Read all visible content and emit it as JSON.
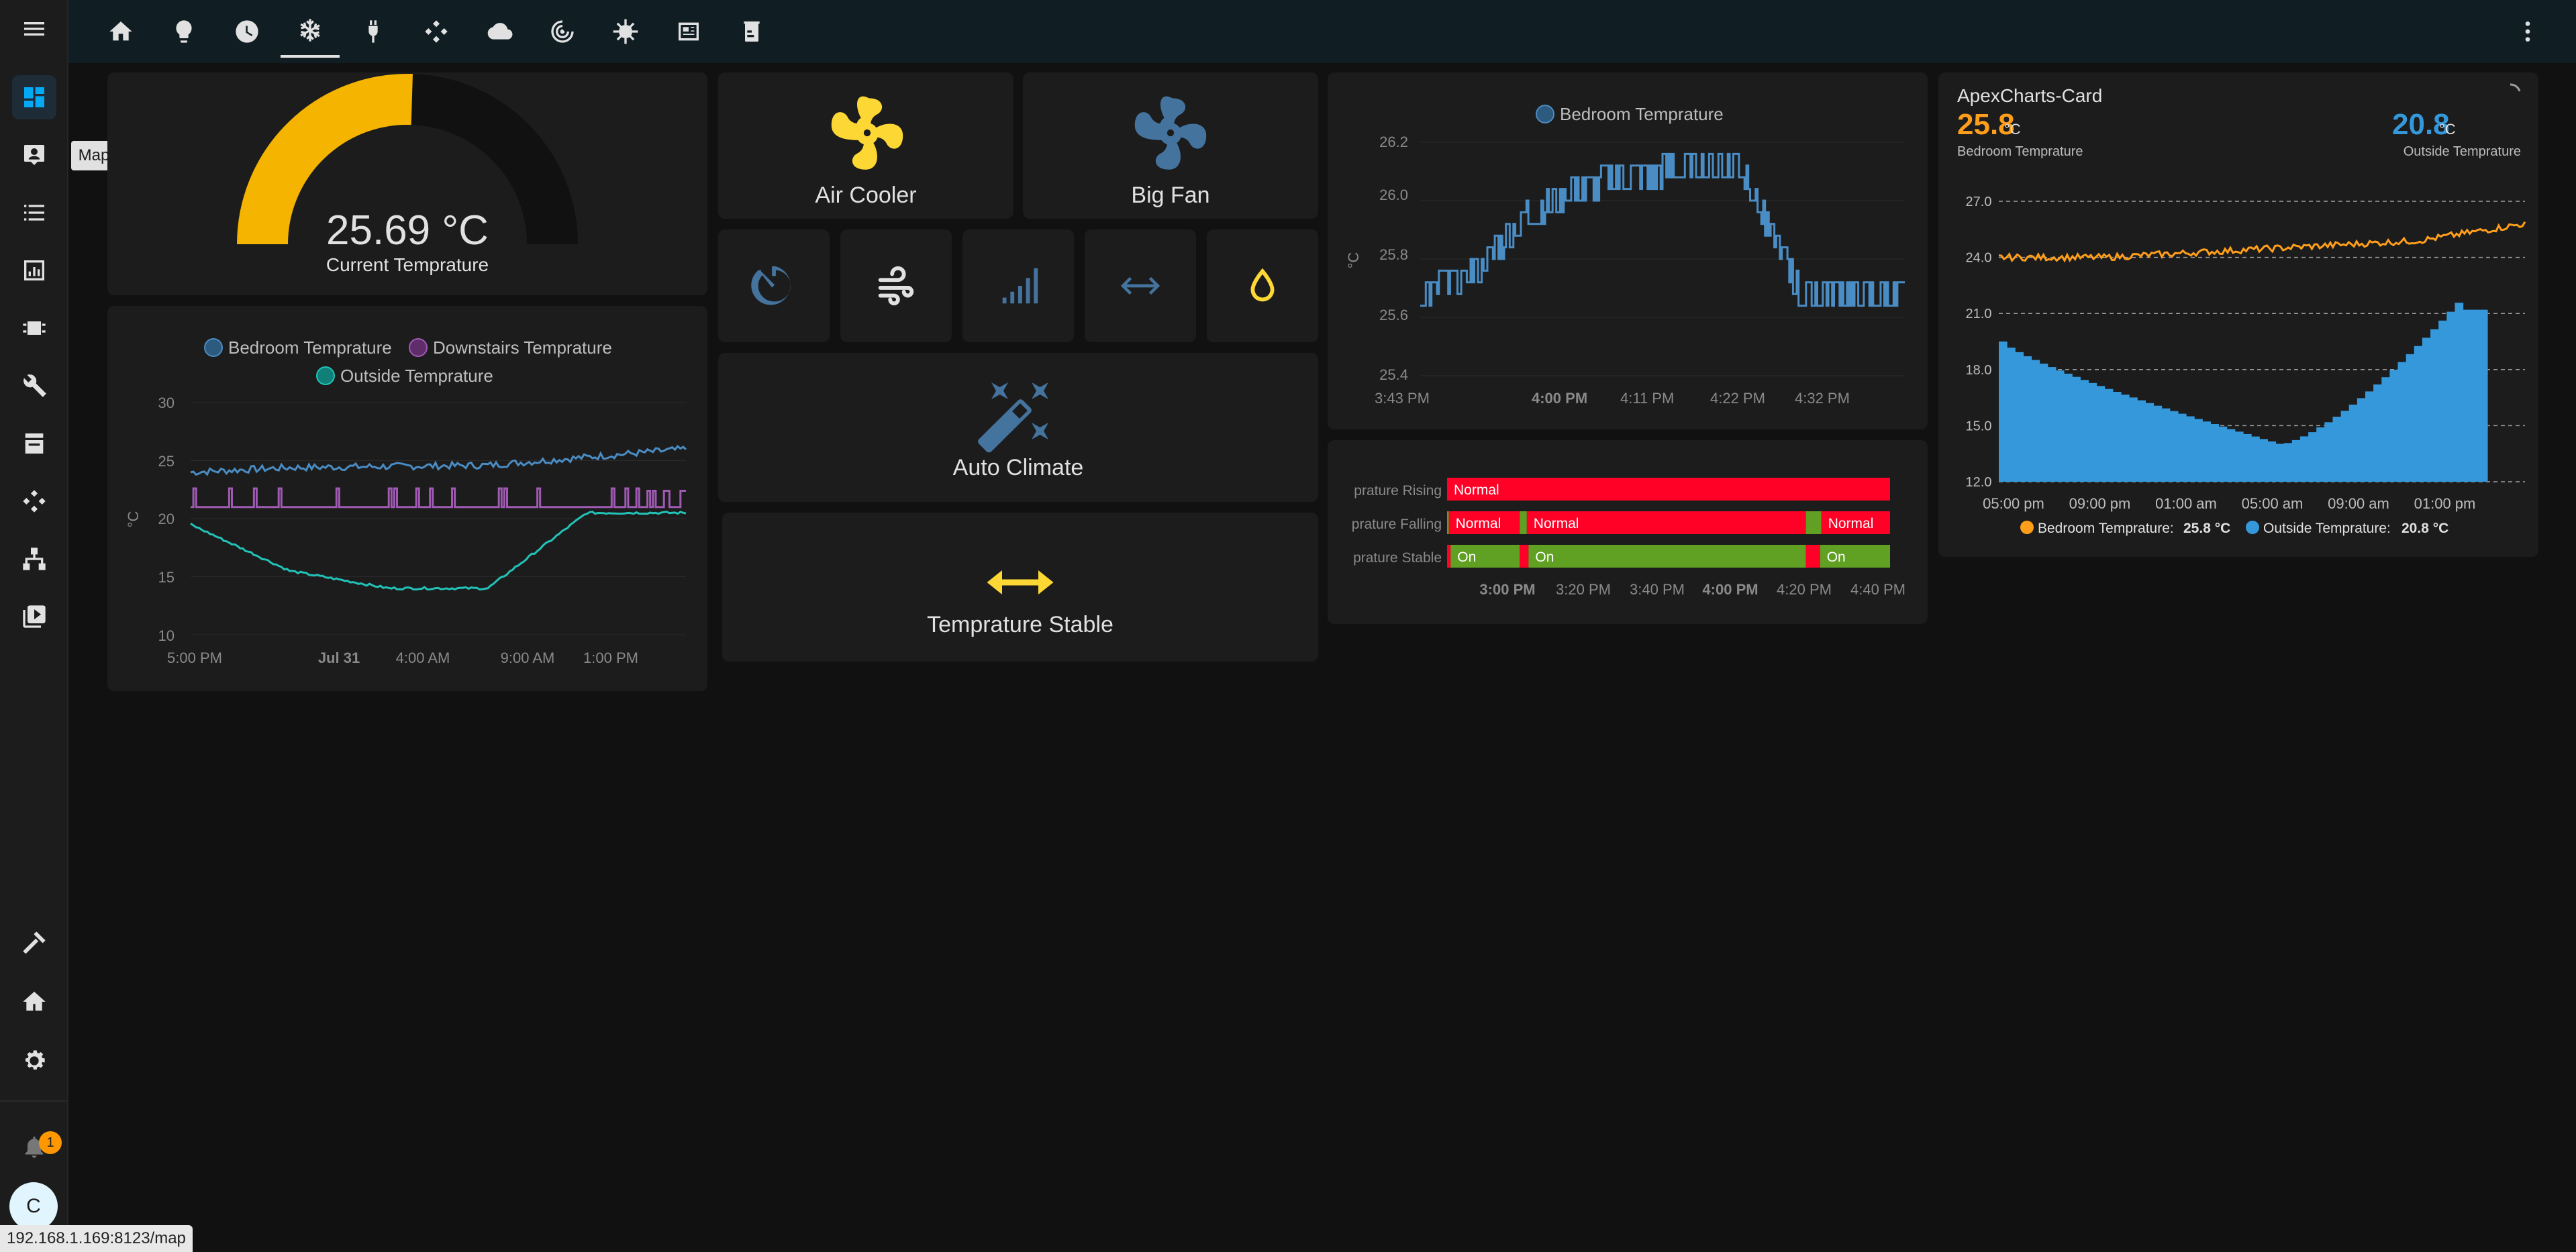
{
  "tooltip": "Map",
  "notifications": {
    "count": "1"
  },
  "user": {
    "initial": "C"
  },
  "statusbar": {
    "url": "192.168.1.169:8123/map"
  },
  "colors": {
    "accent": "#03a9f4",
    "gauge": "#f4b400",
    "fan_blue": "#44739e",
    "yellow": "#fdd835",
    "red": "#ff0026",
    "green": "#60a022"
  },
  "sidebar": {
    "items": [
      {
        "icon": "menu-icon"
      },
      {
        "icon": "dashboard-icon"
      },
      {
        "icon": "map-icon"
      },
      {
        "icon": "logbook-icon"
      },
      {
        "icon": "history-icon"
      },
      {
        "icon": "esphome-icon"
      },
      {
        "icon": "developer-tools-icon"
      },
      {
        "icon": "hacs-icon"
      },
      {
        "icon": "vscode-icon"
      },
      {
        "icon": "network-icon"
      },
      {
        "icon": "media-icon"
      },
      {
        "icon": "hammer-icon"
      },
      {
        "icon": "home-cog-icon"
      },
      {
        "icon": "settings-icon"
      },
      {
        "icon": "bell-icon"
      }
    ]
  },
  "tabs": [
    {
      "icon": "home-icon"
    },
    {
      "icon": "bulb-icon"
    },
    {
      "icon": "clock-icon"
    },
    {
      "icon": "snowflake-icon"
    },
    {
      "icon": "plug-icon"
    },
    {
      "icon": "vscode-icon"
    },
    {
      "icon": "cloud-icon"
    },
    {
      "icon": "radar-icon"
    },
    {
      "icon": "virus-icon"
    },
    {
      "icon": "card-icon"
    },
    {
      "icon": "beaker-icon"
    }
  ],
  "gauge": {
    "value": "25.69 °C",
    "label": "Current Temprature",
    "fraction": 0.51
  },
  "fans": [
    {
      "name": "Air Cooler"
    },
    {
      "name": "Big Fan"
    }
  ],
  "small_buttons": [
    {
      "icon": "timer-icon"
    },
    {
      "icon": "wind-icon"
    },
    {
      "icon": "signal-icon"
    },
    {
      "icon": "swing-icon"
    },
    {
      "icon": "drop-icon"
    }
  ],
  "auto_climate": {
    "name": "Auto Climate"
  },
  "stable": {
    "name": "Temprature Stable"
  },
  "history_chart": {
    "legend": [
      "Bedroom Temprature",
      "Downstairs Temprature",
      "Outside Temprature"
    ],
    "unit": "°C",
    "yticks": [
      "30",
      "25",
      "20",
      "15",
      "10"
    ],
    "xticks": [
      "5:00 PM",
      "Jul 31",
      "4:00 AM",
      "9:00 AM",
      "1:00 PM"
    ]
  },
  "bedroom_chart": {
    "legend": "Bedroom Temprature",
    "unit": "°C",
    "yticks": [
      "26.2",
      "26.0",
      "25.8",
      "25.6",
      "25.4"
    ],
    "xticks": [
      "3:43 PM",
      "4:00 PM",
      "4:11 PM",
      "4:22 PM",
      "4:32 PM"
    ]
  },
  "timeline": {
    "rows": [
      {
        "label": "prature Rising",
        "segs": [
          {
            "t": "Normal",
            "c": "red",
            "f": 1
          }
        ]
      },
      {
        "label": "prature Falling",
        "segs": [
          {
            "t": "",
            "c": "green",
            "f": 0.004
          },
          {
            "t": "Normal",
            "c": "red",
            "f": 0.16
          },
          {
            "t": "",
            "c": "green",
            "f": 0.016
          },
          {
            "t": "Normal",
            "c": "red",
            "f": 0.63
          },
          {
            "t": "",
            "c": "green",
            "f": 0.035
          },
          {
            "t": "Normal",
            "c": "red",
            "f": 0.155
          }
        ]
      },
      {
        "label": "prature Stable",
        "segs": [
          {
            "t": "",
            "c": "red",
            "f": 0.008
          },
          {
            "t": "On",
            "c": "green",
            "f": 0.156
          },
          {
            "t": "",
            "c": "red",
            "f": 0.02
          },
          {
            "t": "On",
            "c": "green",
            "f": 0.626
          },
          {
            "t": "",
            "c": "red",
            "f": 0.032
          },
          {
            "t": "On",
            "c": "green",
            "f": 0.158
          }
        ]
      }
    ],
    "xticks": [
      "3:00 PM",
      "3:20 PM",
      "3:40 PM",
      "4:00 PM",
      "4:20 PM",
      "4:40 PM"
    ]
  },
  "apex": {
    "title": "ApexCharts-Card",
    "bedroom": {
      "value": "25.8",
      "unit": "°C",
      "name": "Bedroom Temprature"
    },
    "outside": {
      "value": "20.8",
      "unit": "°C",
      "name": "Outside Temprature"
    },
    "legend_bedroom": "Bedroom Temprature:",
    "legend_bedroom_val": "25.8 °C",
    "legend_outside": "Outside Temprature:",
    "legend_outside_val": "20.8 °C"
  },
  "chart_data": [
    {
      "type": "line",
      "title": "",
      "ylabel": "°C",
      "ylim": [
        10,
        30
      ],
      "x": [
        "5:00 PM",
        "Jul 31",
        "4:00 AM",
        "9:00 AM",
        "1:00 PM",
        "~3:40 PM"
      ],
      "series": [
        {
          "name": "Bedroom Temprature",
          "values": [
            24,
            24.4,
            24.5,
            24.6,
            25.3,
            26
          ]
        },
        {
          "name": "Downstairs Temprature",
          "values": [
            21,
            21,
            21,
            21,
            22,
            21.5
          ]
        },
        {
          "name": "Outside Temprature",
          "values": [
            19.5,
            15.5,
            14,
            14,
            20.5,
            20.5
          ]
        }
      ]
    },
    {
      "type": "line",
      "title": "",
      "ylabel": "°C",
      "ylim": [
        25.4,
        26.2
      ],
      "x": [
        "3:43 PM",
        "3:50 PM",
        "4:00 PM",
        "4:06 PM",
        "4:11 PM",
        "4:15 PM",
        "4:20 PM",
        "4:26 PM",
        "4:32 PM",
        "4:38 PM"
      ],
      "series": [
        {
          "name": "Bedroom Temprature",
          "values": [
            25.68,
            25.75,
            25.95,
            26.05,
            26.08,
            26.12,
            26.1,
            25.7,
            25.68,
            25.68
          ]
        }
      ]
    },
    {
      "type": "bar",
      "title": "",
      "ylim": [
        12,
        27
      ],
      "x": [
        "05:00 pm",
        "09:00 pm",
        "01:00 am",
        "05:00 am",
        "09:00 am",
        "01:00 pm"
      ],
      "series": [
        {
          "name": "Bedroom Temprature",
          "type": "line",
          "values": [
            24,
            24,
            24.3,
            24.6,
            24.9,
            25.8
          ]
        },
        {
          "name": "Outside Temprature",
          "type": "column",
          "values": [
            19.5,
            16.5,
            15,
            14,
            16.5,
            20.8
          ]
        }
      ]
    }
  ]
}
